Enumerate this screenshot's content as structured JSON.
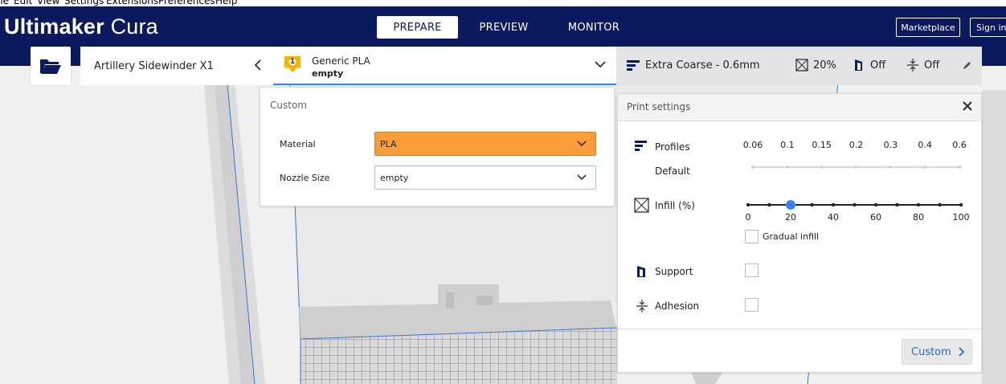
{
  "menubar": [
    "ile",
    "Edit",
    "View",
    "Settings",
    "Extensions",
    "Preferences",
    "Help"
  ],
  "app": {
    "brand_bold": "Ultimaker",
    "brand_light": "Cura"
  },
  "tabs": [
    {
      "label": "PREPARE",
      "active": true
    },
    {
      "label": "PREVIEW",
      "active": false
    },
    {
      "label": "MONITOR",
      "active": false
    }
  ],
  "header_buttons": {
    "marketplace": "Marketplace",
    "signin": "Sign in"
  },
  "stage": {
    "printer": "Artillery Sidewinder X1",
    "extruder_number": "1",
    "material_name": "Generic PLA",
    "nozzle": "empty"
  },
  "print_bar": {
    "profile": "Extra Coarse - 0.6mm",
    "infill": "20%",
    "support": "Off",
    "adhesion": "Off"
  },
  "custom_panel": {
    "title": "Custom",
    "material_label": "Material",
    "material_value": "PLA",
    "nozzle_label": "Nozzle Size",
    "nozzle_value": "empty"
  },
  "print_settings": {
    "title": "Print settings",
    "profiles_label": "Profiles",
    "profiles_sub": "Default",
    "layer_heights": [
      "0.06",
      "0.1",
      "0.15",
      "0.2",
      "0.3",
      "0.4",
      "0.6"
    ],
    "infill_label": "Infill (%)",
    "infill_ticks": [
      "0",
      "20",
      "40",
      "60",
      "80",
      "100"
    ],
    "infill_value": 20,
    "gradual_label": "Gradual infill",
    "support_label": "Support",
    "adhesion_label": "Adhesion",
    "custom_button": "Custom"
  },
  "colors": {
    "header": "#0b1a5e",
    "accent": "#3282ff",
    "material": "#fc9d3c",
    "link": "#1f6cd6"
  }
}
